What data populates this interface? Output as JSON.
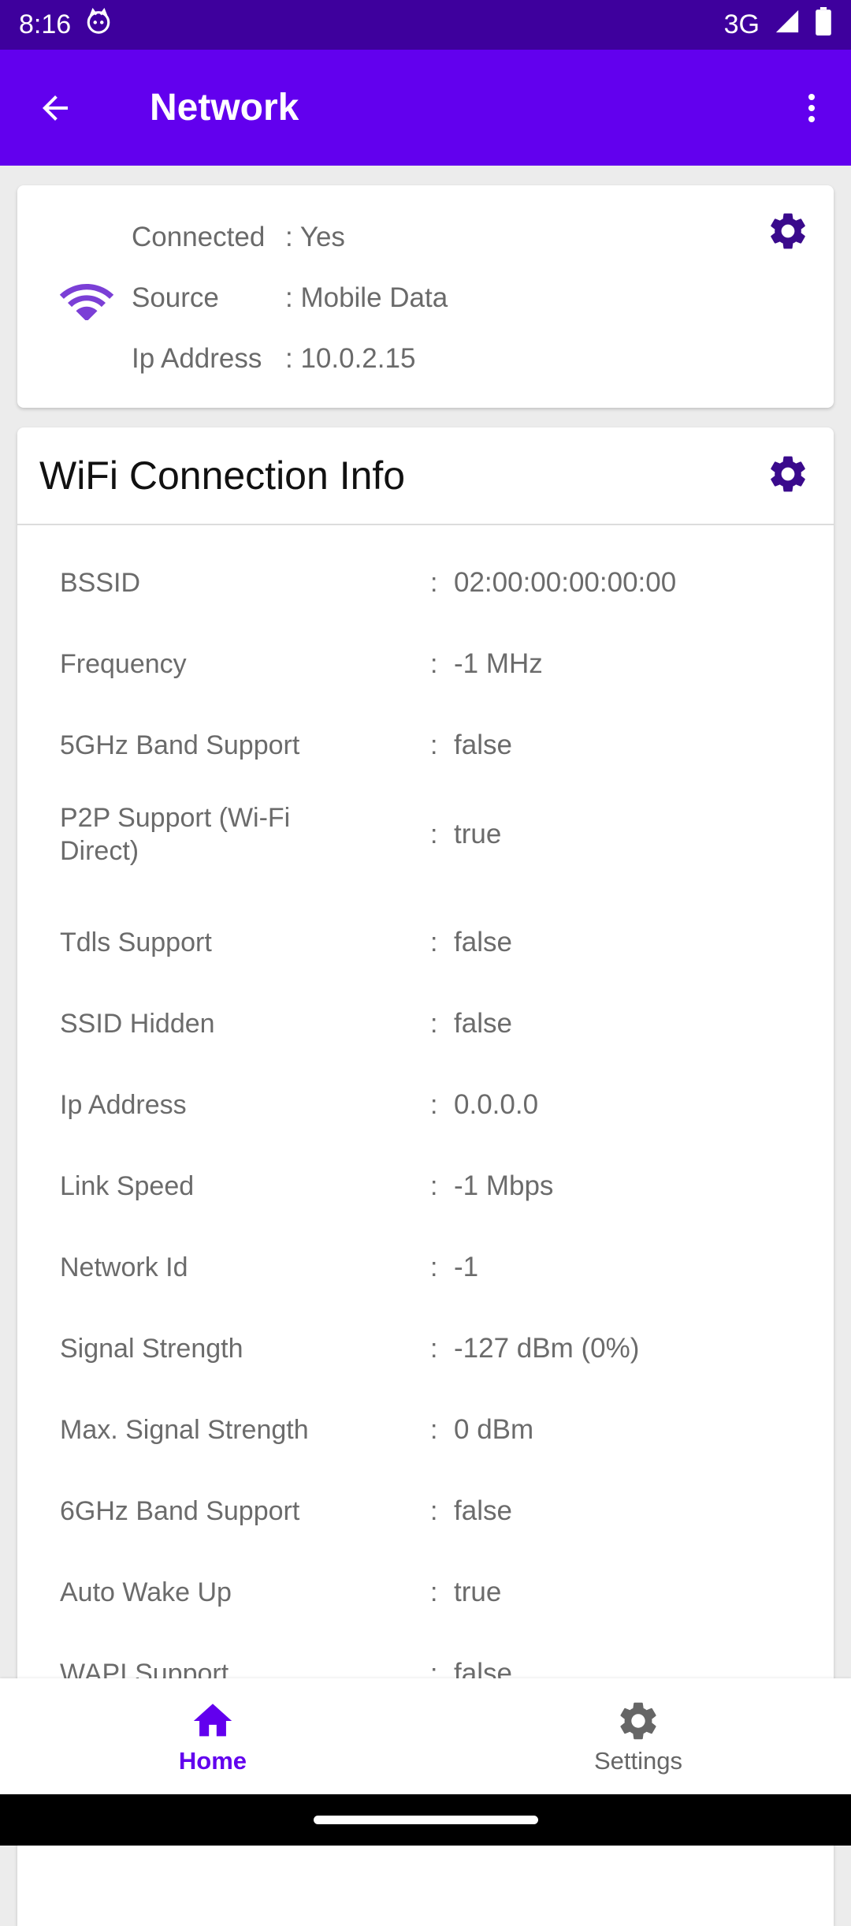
{
  "status": {
    "time": "8:16",
    "network": "3G"
  },
  "app_bar": {
    "title": "Network"
  },
  "summary": {
    "rows": [
      {
        "label": "Connected",
        "value": ": Yes"
      },
      {
        "label": "Source",
        "value": ": Mobile Data"
      },
      {
        "label": "Ip Address",
        "value": ": 10.0.2.15"
      }
    ]
  },
  "wifi_info": {
    "title": "WiFi Connection Info",
    "separator": ":",
    "rows": [
      {
        "label": "BSSID",
        "value": "02:00:00:00:00:00"
      },
      {
        "label": "Frequency",
        "value": "-1 MHz"
      },
      {
        "label": "5GHz Band Support",
        "value": "false"
      },
      {
        "label": "P2P Support (Wi-Fi Direct)",
        "value": "true"
      },
      {
        "label": "Tdls Support",
        "value": "false"
      },
      {
        "label": "SSID Hidden",
        "value": "false"
      },
      {
        "label": "Ip Address",
        "value": "0.0.0.0"
      },
      {
        "label": "Link Speed",
        "value": "-1 Mbps"
      },
      {
        "label": "Network Id",
        "value": "-1"
      },
      {
        "label": "Signal Strength",
        "value": "-127 dBm (0%)"
      },
      {
        "label": "Max. Signal Strength",
        "value": "0 dBm"
      },
      {
        "label": "6GHz Band Support",
        "value": "false"
      },
      {
        "label": "Auto Wake Up",
        "value": "true"
      },
      {
        "label": "WAPI Support",
        "value": "false"
      }
    ]
  },
  "bottom_nav": {
    "home": "Home",
    "settings": "Settings"
  },
  "colors": {
    "primary": "#6200ee",
    "status_bar": "#3e009d",
    "icon_dark": "#3a0a8c",
    "wifi_icon": "#7b3fd6"
  }
}
